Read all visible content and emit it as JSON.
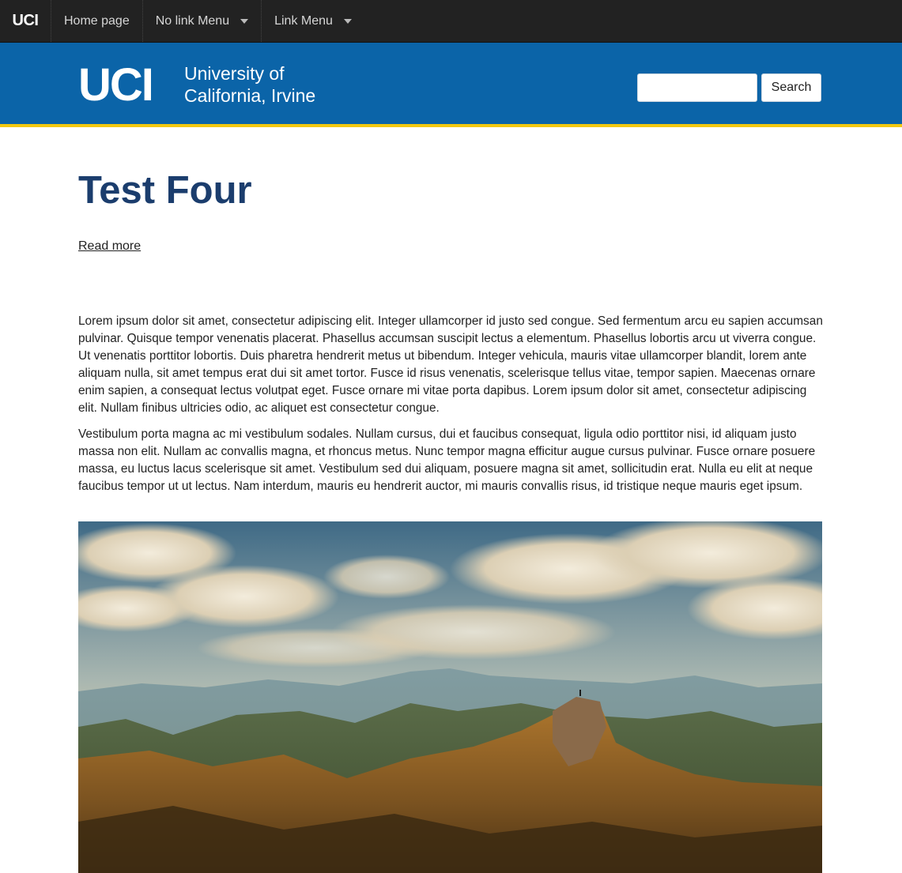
{
  "topnav": {
    "brand": "UCI",
    "items": [
      {
        "label": "Home page",
        "has_dropdown": false
      },
      {
        "label": "No link Menu",
        "has_dropdown": true
      },
      {
        "label": "Link Menu",
        "has_dropdown": true
      }
    ]
  },
  "header": {
    "logo_mark": "UCI",
    "logo_line1": "University of",
    "logo_line2": "California, Irvine",
    "search": {
      "value": "",
      "placeholder": "",
      "button_label": "Search"
    }
  },
  "colors": {
    "topnav_bg": "#222222",
    "header_bg": "#0b64a8",
    "accent_yellow": "#f2c80f",
    "title_color": "#1b3d6d"
  },
  "main": {
    "title": "Test Four",
    "read_more": "Read more",
    "paragraphs": [
      "Lorem ipsum dolor sit amet, consectetur adipiscing elit. Integer ullamcorper id justo sed congue. Sed fermentum arcu eu sapien accumsan pulvinar. Quisque tempor venenatis placerat. Phasellus accumsan suscipit lectus a elementum. Phasellus lobortis arcu ut viverra congue. Ut venenatis porttitor lobortis. Duis pharetra hendrerit metus ut bibendum. Integer vehicula, mauris vitae ullamcorper blandit, lorem ante aliquam nulla, sit amet tempus erat dui sit amet tortor. Fusce id risus venenatis, scelerisque tellus vitae, tempor sapien. Maecenas ornare enim sapien, a consequat lectus volutpat eget. Fusce ornare mi vitae porta dapibus. Lorem ipsum dolor sit amet, consectetur adipiscing elit. Nullam finibus ultricies odio, ac aliquet est consectetur congue.",
      "Vestibulum porta magna ac mi vestibulum sodales. Nullam cursus, dui et faucibus consequat, ligula odio porttitor nisi, id aliquam justo massa non elit. Nullam ac convallis magna, et rhoncus metus. Nunc tempor magna efficitur augue cursus pulvinar. Fusce ornare posuere massa, eu luctus lacus scelerisque sit amet. Vestibulum sed dui aliquam, posuere magna sit amet, sollicitudin erat. Nulla eu elit at neque faucibus tempor ut ut lectus. Nam interdum, mauris eu hendrerit auctor, mi mauris convallis risus, id tristique neque mauris eget ipsum."
    ]
  }
}
